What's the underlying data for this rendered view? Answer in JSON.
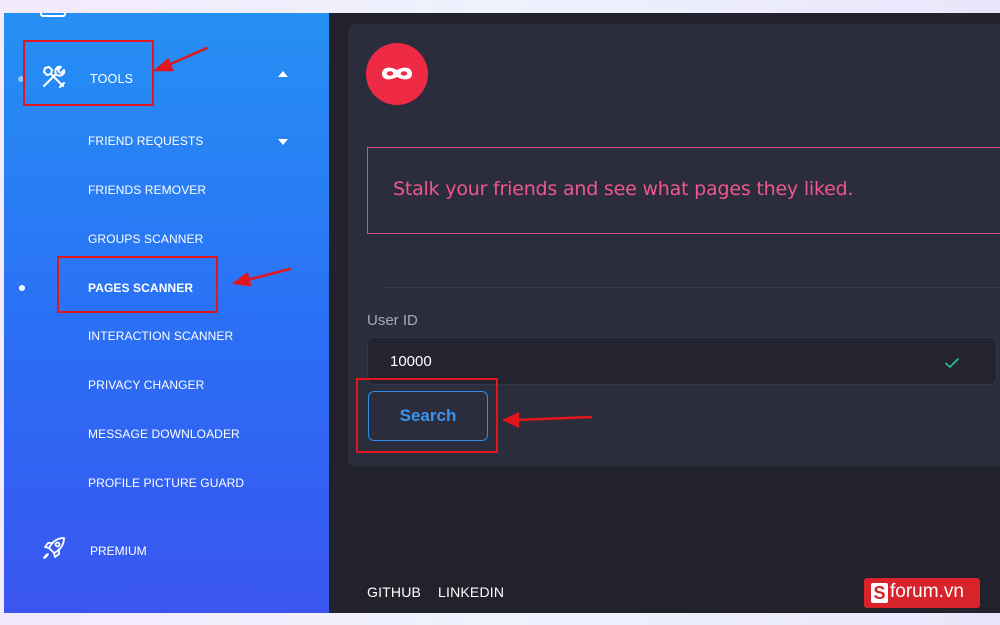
{
  "sidebar": {
    "tools_label": "TOOLS",
    "items": [
      {
        "label": "FRIEND REQUESTS"
      },
      {
        "label": "FRIENDS REMOVER"
      },
      {
        "label": "GROUPS SCANNER"
      },
      {
        "label": "PAGES SCANNER",
        "active": true
      },
      {
        "label": "INTERACTION SCANNER"
      },
      {
        "label": "PRIVACY CHANGER"
      },
      {
        "label": "MESSAGE DOWNLOADER"
      },
      {
        "label": "PROFILE PICTURE GUARD"
      }
    ],
    "premium_label": "PREMIUM"
  },
  "main": {
    "message": "Stalk your friends and see what pages they liked.",
    "field_label": "User ID",
    "user_id_value": "10000",
    "search_label": "Search"
  },
  "footer": {
    "github": "GITHUB",
    "linkedin": "LINKEDIN"
  },
  "watermark": {
    "letter": "S",
    "text": "forum.vn"
  },
  "colors": {
    "sidebar_top": "#2590f4",
    "sidebar_bottom": "#3a55f0",
    "background": "#21222c",
    "panel": "#2b2c3c",
    "accent_pink": "#f0568f",
    "accent_blue": "#3a94f2",
    "logo_red": "#ee2a45",
    "annotation_red": "#e2161d"
  },
  "icons": [
    "tools-icon",
    "rocket-icon",
    "mask-icon",
    "checkmark-icon",
    "caret-up-icon",
    "caret-down-icon"
  ]
}
